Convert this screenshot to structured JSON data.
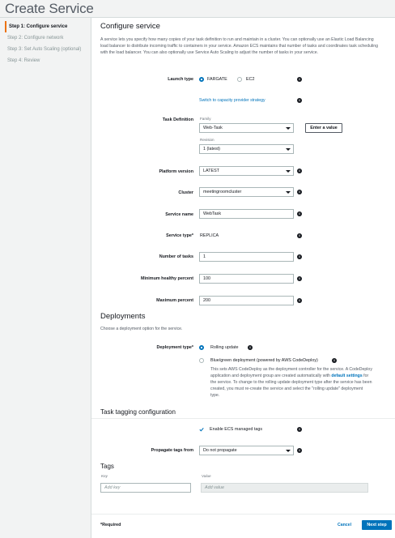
{
  "title": "Create Service",
  "steps": [
    "Step 1: Configure service",
    "Step 2: Configure network",
    "Step 3: Set Auto Scaling (optional)",
    "Step 4: Review"
  ],
  "configure": {
    "heading": "Configure service",
    "description": "A service lets you specify how many copies of your task definition to run and maintain in a cluster. You can optionally use an Elastic Load Balancing load balancer to distribute incoming traffic to containers in your service. Amazon ECS maintains that number of tasks and coordinates task scheduling with the load balancer. You can also optionally use Service Auto Scaling to adjust the number of tasks in your service.",
    "launch_type_label": "Launch type",
    "launch_option_fargate": "FARGATE",
    "launch_option_ec2": "EC2",
    "capacity_link": "Switch to capacity provider strategy",
    "task_def_label": "Task Definition",
    "family_label": "Family",
    "family_value": "Web-Task",
    "enter_value_button": "Enter a value",
    "revision_label": "Revision",
    "revision_value": "1 (latest)",
    "platform_label": "Platform version",
    "platform_value": "LATEST",
    "cluster_label": "Cluster",
    "cluster_value": "meetingroomcluster",
    "service_name_label": "Service name",
    "service_name_value": "WebTask",
    "service_type_label": "Service type*",
    "service_type_value": "REPLICA",
    "num_tasks_label": "Number of tasks",
    "num_tasks_value": "1",
    "min_healthy_label": "Minimum healthy percent",
    "min_healthy_value": "100",
    "max_percent_label": "Maximum percent",
    "max_percent_value": "200"
  },
  "deployments": {
    "heading": "Deployments",
    "description": "Choose a deployment option for the service.",
    "type_label": "Deployment type*",
    "rolling_label": "Rolling update",
    "bluegreen_label": "Blue/green deployment (powered by AWS CodeDeploy)",
    "bluegreen_desc_1": "This sets AWS CodeDeploy as the deployment controller for the service. A CodeDeploy application and deployment group are created automatically with ",
    "bluegreen_desc_link": "default settings",
    "bluegreen_desc_2": " for the service. To change to the rolling update deployment type after the service has been created, you must re-create the service and select the \"rolling update\" deployment type."
  },
  "tagging": {
    "heading": "Task tagging configuration",
    "ecs_managed_label": "Enable ECS managed tags",
    "propagate_label": "Propagate tags from",
    "propagate_value": "Do not propagate"
  },
  "tags": {
    "heading": "Tags",
    "key_col": "Key",
    "value_col": "Value",
    "key_placeholder": "Add key",
    "value_placeholder": "Add value"
  },
  "footer": {
    "required_note": "*Required",
    "cancel": "Cancel",
    "next": "Next step"
  },
  "colors": {
    "accent": "#0073bb",
    "active_step": "#ec7211"
  }
}
